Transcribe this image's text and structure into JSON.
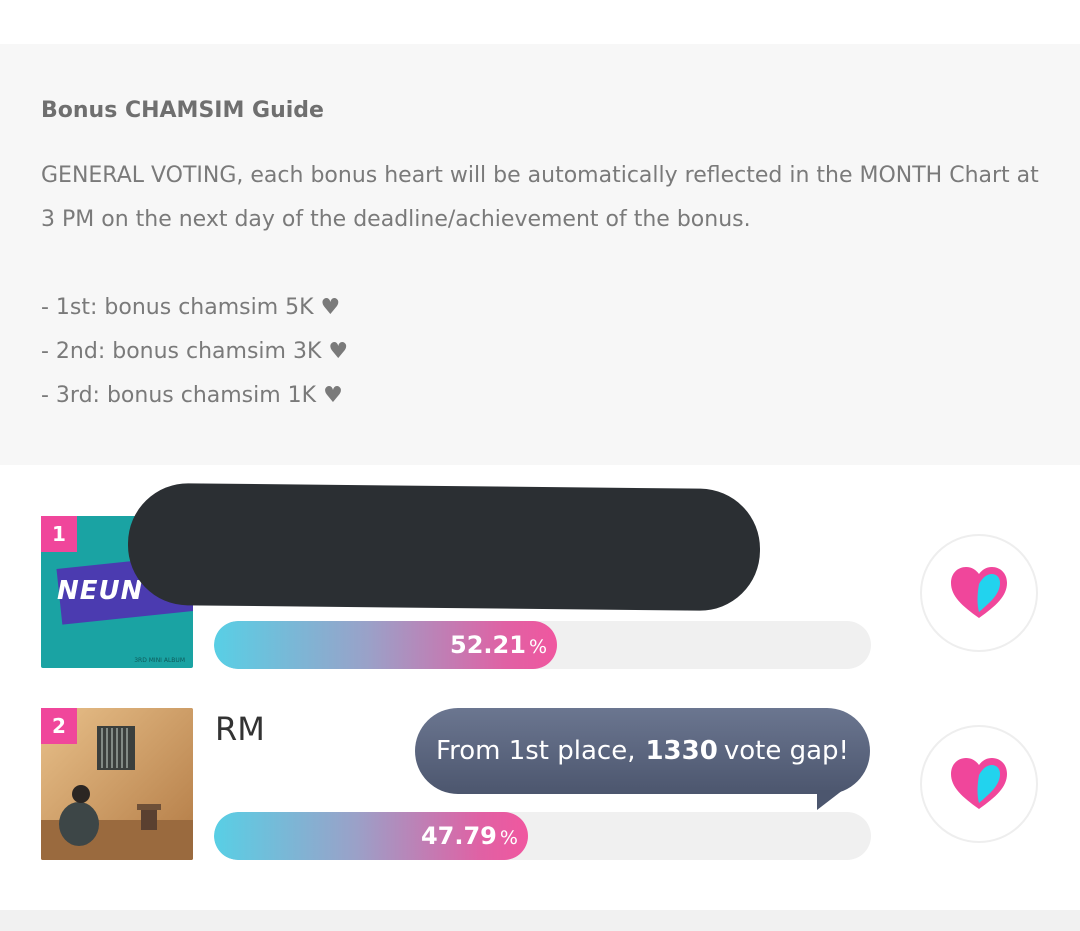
{
  "guide": {
    "title": "Bonus CHAMSIM Guide",
    "description": "GENERAL VOTING, each bonus heart will be automatically reflected in the MONTH Chart at 3 PM on the next day of the deadline/achievement of the bonus.",
    "bonus_lines": [
      "- 1st: bonus chamsim 5K ♥",
      "- 2nd: bonus chamsim 3K ♥",
      "- 3rd: bonus chamsim 1K ♥"
    ]
  },
  "ranking": [
    {
      "rank": "1",
      "album_text": "NEUN",
      "album_caption": "3RD MINI ALBUM",
      "artist": "",
      "percent": 52.21,
      "percent_label": "52.21",
      "unit": "%"
    },
    {
      "rank": "2",
      "artist": "RM",
      "percent": 47.79,
      "percent_label": "47.79",
      "unit": "%"
    }
  ],
  "gap_tooltip": {
    "prefix": "From 1st place,",
    "value": "1330",
    "suffix": "vote gap!"
  },
  "colors": {
    "accent_pink": "#f0469b",
    "accent_cyan": "#58cfe5",
    "tooltip_bg": "#56607a",
    "redaction": "#2b2f33"
  },
  "icons": [
    "heart-vote-icon"
  ]
}
